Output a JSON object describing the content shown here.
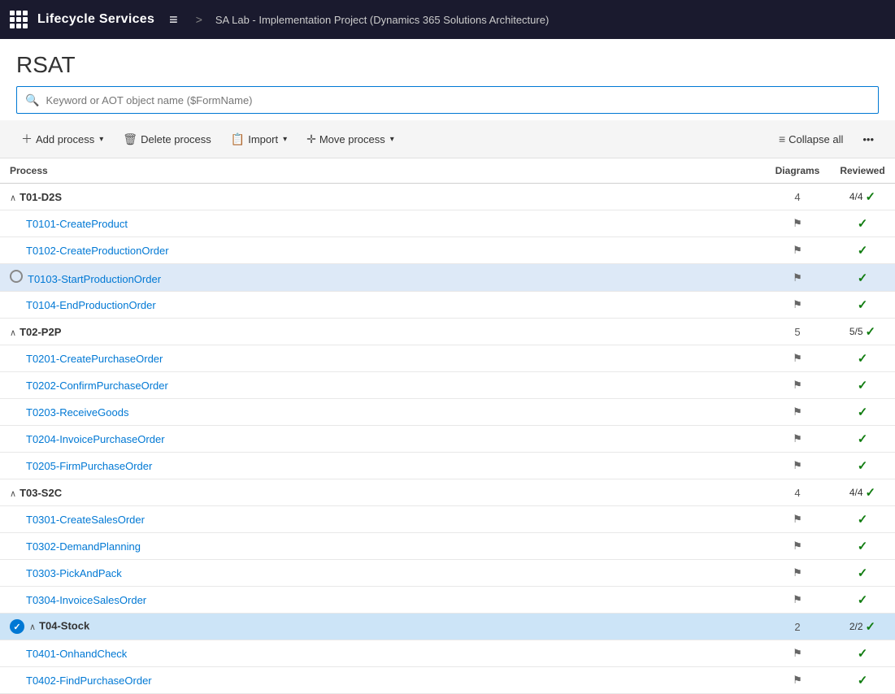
{
  "header": {
    "title": "Lifecycle Services",
    "project": "SA Lab - Implementation Project (Dynamics 365 Solutions Architecture)",
    "separator": ">"
  },
  "page": {
    "title": "RSAT"
  },
  "search": {
    "placeholder": "Keyword or AOT object name ($FormName)"
  },
  "toolbar": {
    "add_process": "Add process",
    "delete_process": "Delete process",
    "import": "Import",
    "move_process": "Move process",
    "collapse_all": "Collapse all"
  },
  "table": {
    "columns": {
      "process": "Process",
      "diagrams": "Diagrams",
      "reviewed": "Reviewed"
    },
    "groups": [
      {
        "id": "T01-D2S",
        "diagrams": "4",
        "reviewed": "4/4",
        "children": [
          {
            "id": "T0101-CreateProduct",
            "diagrams": "⚐",
            "reviewed": "✓"
          },
          {
            "id": "T0102-CreateProductionOrder",
            "diagrams": "⚐",
            "reviewed": "✓"
          },
          {
            "id": "T0103-StartProductionOrder",
            "diagrams": "⚐",
            "reviewed": "✓",
            "selected": true,
            "radio": true
          },
          {
            "id": "T0104-EndProductionOrder",
            "diagrams": "⚐",
            "reviewed": "✓"
          }
        ]
      },
      {
        "id": "T02-P2P",
        "diagrams": "5",
        "reviewed": "5/5",
        "children": [
          {
            "id": "T0201-CreatePurchaseOrder",
            "diagrams": "⚐",
            "reviewed": "✓"
          },
          {
            "id": "T0202-ConfirmPurchaseOrder",
            "diagrams": "⚐",
            "reviewed": "✓"
          },
          {
            "id": "T0203-ReceiveGoods",
            "diagrams": "⚐",
            "reviewed": "✓"
          },
          {
            "id": "T0204-InvoicePurchaseOrder",
            "diagrams": "⚐",
            "reviewed": "✓"
          },
          {
            "id": "T0205-FirmPurchaseOrder",
            "diagrams": "⚐",
            "reviewed": "✓"
          }
        ]
      },
      {
        "id": "T03-S2C",
        "diagrams": "4",
        "reviewed": "4/4",
        "children": [
          {
            "id": "T0301-CreateSalesOrder",
            "diagrams": "⚐",
            "reviewed": "✓"
          },
          {
            "id": "T0302-DemandPlanning",
            "diagrams": "⚐",
            "reviewed": "✓"
          },
          {
            "id": "T0303-PickAndPack",
            "diagrams": "⚐",
            "reviewed": "✓"
          },
          {
            "id": "T0304-InvoiceSalesOrder",
            "diagrams": "⚐",
            "reviewed": "✓"
          }
        ]
      },
      {
        "id": "T04-Stock",
        "diagrams": "2",
        "reviewed": "2/2",
        "selectedGroup": true,
        "children": [
          {
            "id": "T0401-OnhandCheck",
            "diagrams": "⚐",
            "reviewed": "✓"
          },
          {
            "id": "T0402-FindPurchaseOrder",
            "diagrams": "⚐",
            "reviewed": "✓"
          }
        ]
      }
    ]
  }
}
